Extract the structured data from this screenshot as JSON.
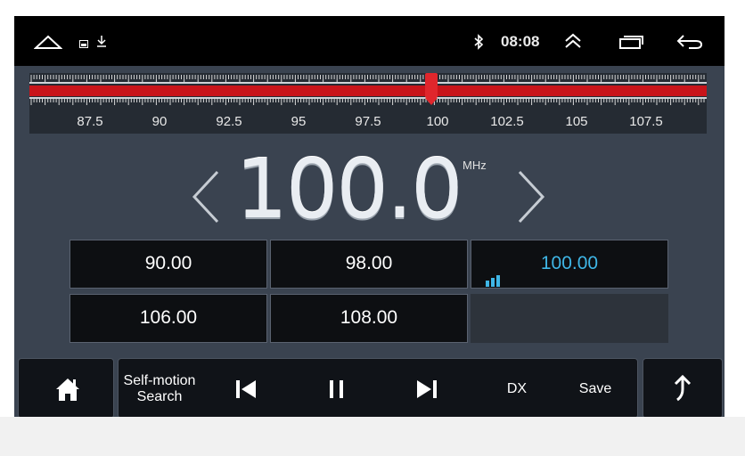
{
  "status_bar": {
    "time": "08:08",
    "icons": [
      "home-outline-icon",
      "image-icon",
      "download-icon",
      "bluetooth-icon",
      "chevron-up-double-icon",
      "recent-apps-icon",
      "back-icon"
    ]
  },
  "tuner": {
    "scale_labels": [
      "87.5",
      "90",
      "92.5",
      "95",
      "97.5",
      "100",
      "102.5",
      "105",
      "107.5"
    ],
    "current_frequency": "100.0",
    "unit": "MHz",
    "accent_color": "#d01818"
  },
  "presets": [
    {
      "label": "90.00",
      "active": false
    },
    {
      "label": "98.00",
      "active": false
    },
    {
      "label": "100.00",
      "active": true
    },
    {
      "label": "106.00",
      "active": false
    },
    {
      "label": "108.00",
      "active": false
    }
  ],
  "controls": {
    "self_motion_line1": "Self-motion",
    "self_motion_line2": "Search",
    "dx_label": "DX",
    "save_label": "Save",
    "icons": [
      "home-icon",
      "previous-icon",
      "pause-icon",
      "next-icon",
      "return-icon"
    ]
  },
  "colors": {
    "background": "#3a4350",
    "active_preset": "#3fb6e6"
  }
}
